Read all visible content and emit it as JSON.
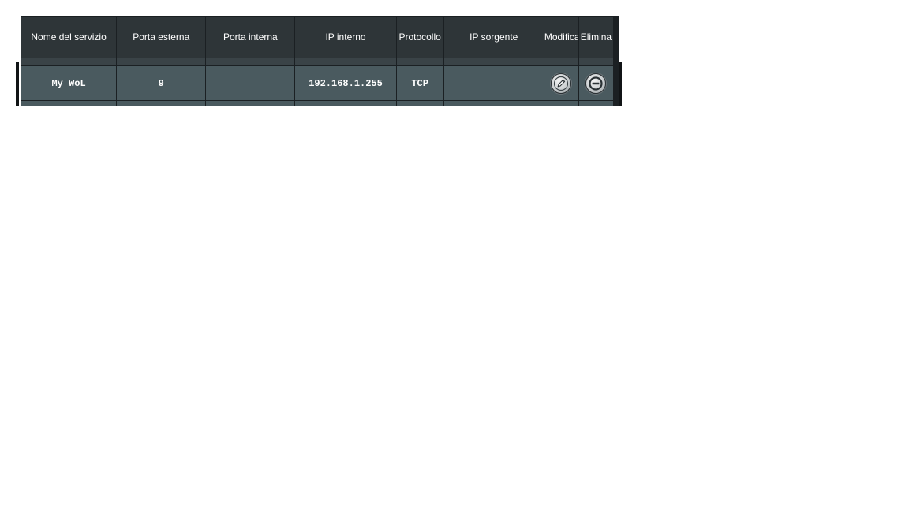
{
  "table": {
    "headers": {
      "service_name": "Nome del servizio",
      "external_port": "Porta esterna",
      "internal_port": "Porta interna",
      "internal_ip": "IP interno",
      "protocol": "Protocollo",
      "source_ip": "IP sorgente",
      "edit": "Modifica",
      "delete": "Elimina"
    },
    "rows": [
      {
        "service_name": "My WoL",
        "external_port": "9",
        "internal_port": "",
        "internal_ip": "192.168.1.255",
        "protocol": "TCP",
        "source_ip": "",
        "edit_icon": "pencil-icon",
        "delete_icon": "minus-circle-icon"
      }
    ]
  },
  "colors": {
    "header_bg": "#2e3538",
    "row_bg": "#4a5a5f",
    "border": "#1b2023",
    "text": "#ffffff"
  }
}
